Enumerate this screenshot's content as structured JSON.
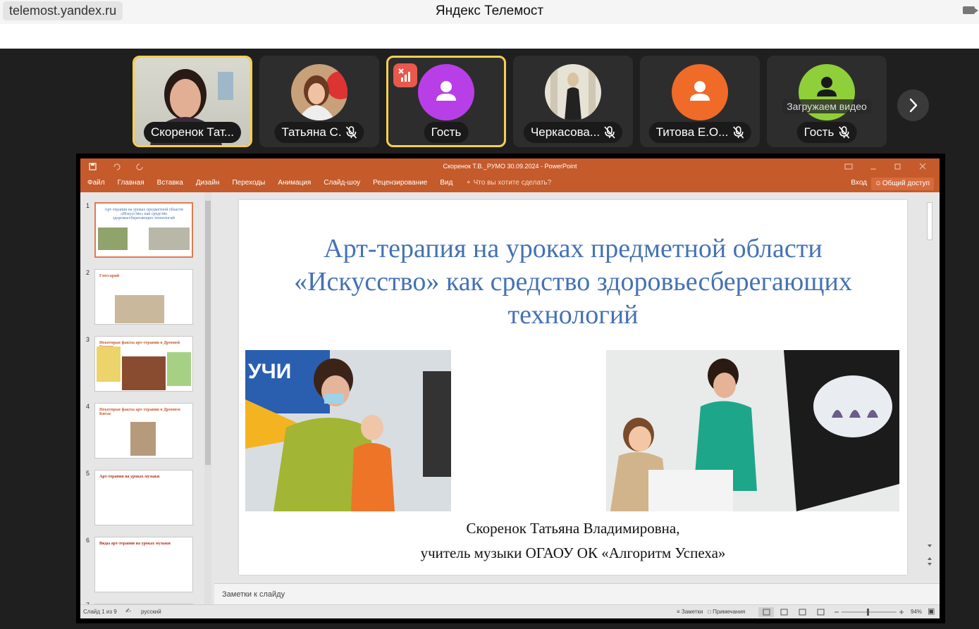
{
  "browser": {
    "url": "telemost.yandex.ru",
    "title": "Яндекс Телемост"
  },
  "participants": [
    {
      "name": "Скоренок Тат...",
      "active": true,
      "muted": false
    },
    {
      "name": "Татьяна С.",
      "active": false,
      "muted": true
    },
    {
      "name": "Гость",
      "active": true,
      "muted": false
    },
    {
      "name": "Черкасова...",
      "active": false,
      "muted": true
    },
    {
      "name": "Титова Е.О...",
      "active": false,
      "muted": true
    },
    {
      "name": "Гость",
      "active": false,
      "muted": true,
      "loading_text": "Загружаем видео"
    }
  ],
  "colors": {
    "accent": "#f5cf53",
    "ppt_brand": "#c55a2b",
    "guest_avatar": "#b83fe8",
    "titova_avatar": "#f06a28",
    "guest2_avatar": "#8fcf3a",
    "slide_title": "#4472b4"
  },
  "ppt": {
    "window_title": "Скоренок Т.В._РУМО 30.09.2024 - PowerPoint",
    "tabs": [
      "Файл",
      "Главная",
      "Вставка",
      "Дизайн",
      "Переходы",
      "Анимация",
      "Слайд-шоу",
      "Рецензирование",
      "Вид"
    ],
    "search_placeholder": "Что вы хотите сделать?",
    "login": "Вход",
    "share": "Общий доступ",
    "thumbnails": [
      {
        "num": "1",
        "title": "Арт-терапия на уроках предметной области «Искусство» как средство здоровьесберегающих технологий"
      },
      {
        "num": "2",
        "title": "Глоссарий"
      },
      {
        "num": "3",
        "title": "Некоторые факты арт-терапии в Древней Греции"
      },
      {
        "num": "4",
        "title": "Некоторые факты арт-терапии в Древнем Китае"
      },
      {
        "num": "5",
        "title": "Арт-терапия на уроках музыки"
      },
      {
        "num": "6",
        "title": "Виды арт-терапии на уроках музыки"
      },
      {
        "num": "7",
        "title": ""
      }
    ],
    "slide": {
      "title": "Арт-терапия на уроках предметной области «Искусство» как средство здоровьесберегающих технологий",
      "author": "Скоренок Татьяна Владимировна,",
      "position": "учитель музыки ОГАОУ ОК «Алгоритм Успеха»"
    },
    "notes_placeholder": "Заметки к слайду",
    "status": {
      "slide": "Слайд 1 из 9",
      "lang": "русский",
      "notes": "Заметки",
      "comments": "Примечания",
      "zoom": "94%"
    }
  }
}
